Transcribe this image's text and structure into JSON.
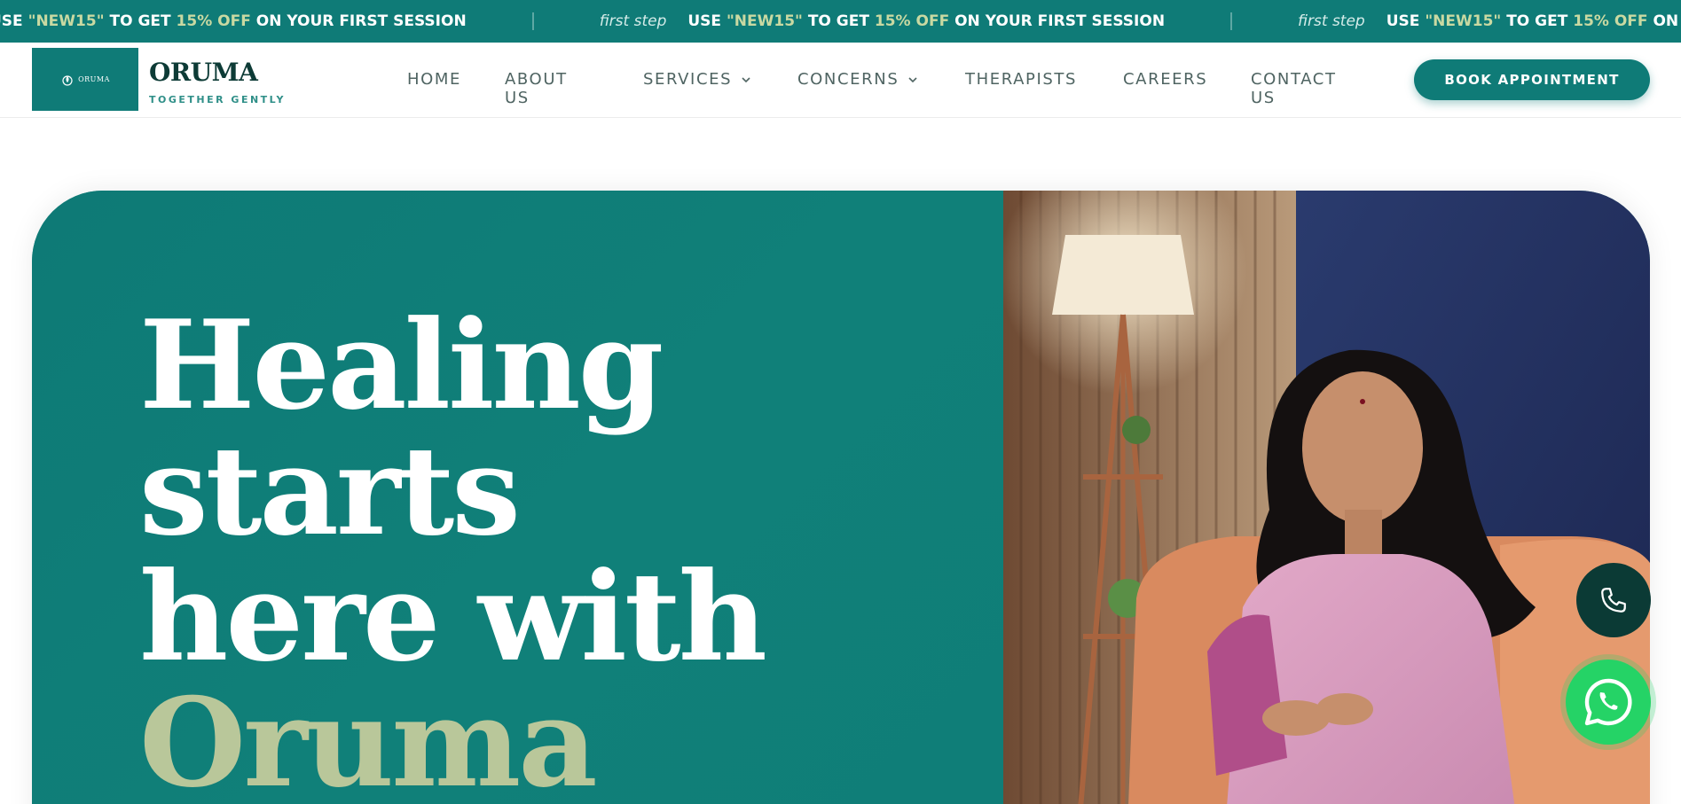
{
  "ticker": {
    "items": [
      {
        "prefix": "USE ",
        "code": "\"NEW15\"",
        "mid": " TO GET ",
        "discount": "15% OFF",
        "suffix": " ON YOUR FIRST SESSION"
      },
      {
        "step": "first step",
        "prefix": "USE ",
        "code": "\"NEW15\"",
        "mid": " TO GET ",
        "discount": "15% OFF",
        "suffix": " ON YOUR FIRST SESSION"
      },
      {
        "step": "first step",
        "prefix": "USE ",
        "code": "\"NEW15\"",
        "mid": " TO GET ",
        "discount": "15% OFF",
        "suffix": " ON YOUR"
      }
    ]
  },
  "header": {
    "logo_mini": "ORUMA",
    "brand_name": "ORUMA",
    "tagline": "TOGETHER GENTLY",
    "nav": [
      {
        "label": "HOME",
        "dropdown": false
      },
      {
        "label": "ABOUT US",
        "dropdown": false
      },
      {
        "label": "SERVICES",
        "dropdown": true
      },
      {
        "label": "CONCERNS",
        "dropdown": true
      },
      {
        "label": "THERAPISTS",
        "dropdown": false
      },
      {
        "label": "CAREERS",
        "dropdown": false
      },
      {
        "label": "CONTACT US",
        "dropdown": false
      }
    ],
    "cta_label": "BOOK APPOINTMENT"
  },
  "hero": {
    "line1": "Healing",
    "line2": "starts",
    "line3": "here with",
    "line4": "Oruma"
  },
  "colors": {
    "brand_teal": "#0f7b77",
    "dark_teal": "#0b3a35",
    "accent_sage": "#b9c79a",
    "whatsapp_green": "#25d366"
  },
  "floating": {
    "phone_icon": "phone-icon",
    "whatsapp_icon": "whatsapp-icon"
  }
}
